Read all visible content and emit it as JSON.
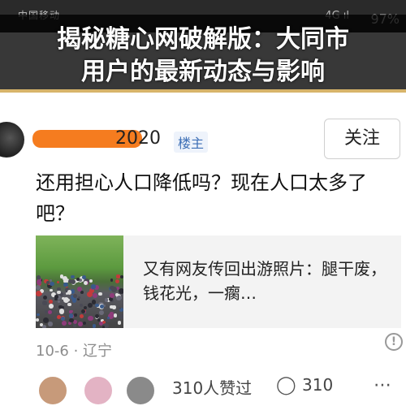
{
  "status_bar": {
    "carrier": "中国移动",
    "signal": "4G ıl",
    "battery": "97%"
  },
  "headline": {
    "line1": "揭秘糖心网破解版：大同市",
    "line2": "用户的最新动态与影响"
  },
  "post": {
    "username_suffix": "2020",
    "host_badge": "楼主",
    "follow_label": "关注",
    "text": "还用担心人口降低吗？现在人口太多了吧？",
    "link": {
      "text": "又有网友传回出游照片：腿干废，钱花光，一瘸…"
    },
    "meta": "10-6 · 辽宁"
  },
  "footer": {
    "likes": "310人赞过",
    "comments": "310"
  },
  "icons": {
    "warning": "warning-icon",
    "comment": "comment-icon",
    "more": "more-icon"
  },
  "colors": {
    "redaction": "#f57c1f",
    "badge": "#3d6fb6",
    "banner": "#000000"
  }
}
